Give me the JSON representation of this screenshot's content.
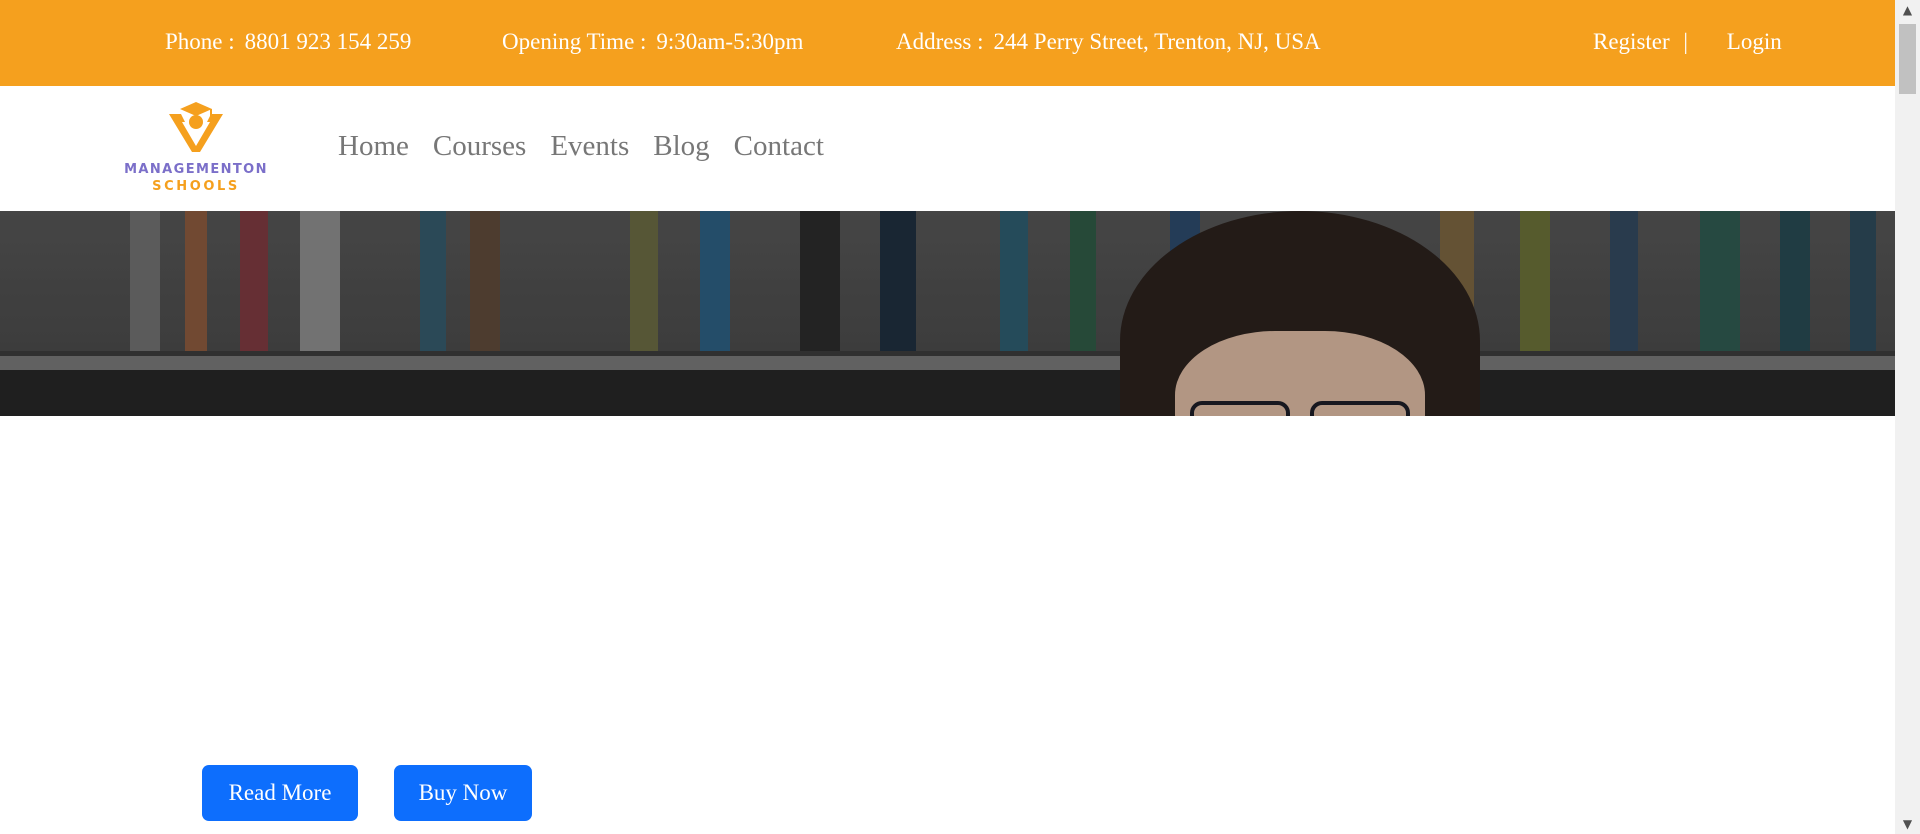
{
  "topbar": {
    "phone_label": "Phone :",
    "phone_value": "8801 923 154 259",
    "hours_label": "Opening Time :",
    "hours_value": "9:30am-5:30pm",
    "address_label": "Address :",
    "address_value": "244 Perry Street, Trenton, NJ, USA",
    "register_label": "Register",
    "separator": "|",
    "login_label": "Login"
  },
  "logo": {
    "line1": "MANAGEMENTON",
    "line2": "SCHOOLS",
    "primary_color": "#7b6fc9",
    "accent_color": "#f5a01e"
  },
  "nav": {
    "items": [
      {
        "label": "Home"
      },
      {
        "label": "Courses"
      },
      {
        "label": "Events"
      },
      {
        "label": "Blog"
      },
      {
        "label": "Contact"
      }
    ]
  },
  "actions": {
    "read_more_label": "Read More",
    "buy_now_label": "Buy Now",
    "button_color": "#0d6efd"
  },
  "colors": {
    "topbar_bg": "#f5a01e"
  },
  "scrollbar": {
    "up_icon": "scroll-up-arrow-icon",
    "down_icon": "scroll-down-arrow-icon"
  }
}
